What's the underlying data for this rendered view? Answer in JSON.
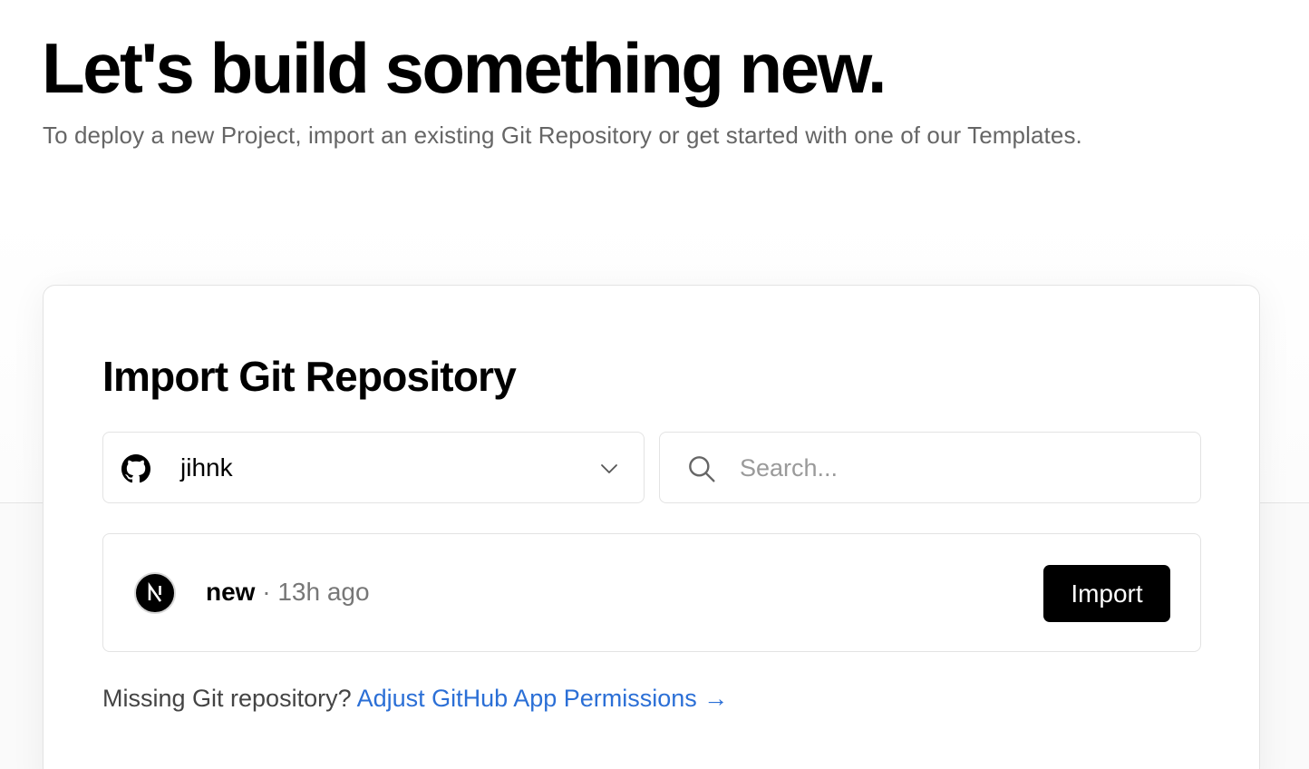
{
  "hero": {
    "title": "Let's build something new.",
    "subtitle": "To deploy a new Project, import an existing Git Repository or get started with one of our Templates."
  },
  "import_card": {
    "title": "Import Git Repository",
    "account_select": {
      "icon": "github-icon",
      "selected": "jihnk"
    },
    "search": {
      "icon": "search-icon",
      "placeholder": "Search...",
      "value": ""
    },
    "repositories": [
      {
        "icon": "nextjs-logo-icon",
        "name": "new",
        "separator": " · ",
        "updated": "13h ago",
        "action_label": "Import"
      }
    ],
    "footer": {
      "text": "Missing Git repository? ",
      "link_label": "Adjust GitHub App Permissions →"
    }
  },
  "colors": {
    "link": "#2b6fd6",
    "button_bg": "#000000",
    "muted_text": "#666666",
    "border": "#e3e3e3"
  }
}
